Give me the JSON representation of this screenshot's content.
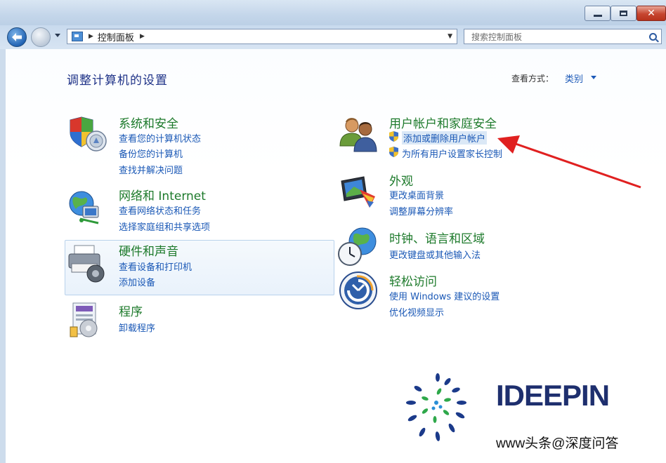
{
  "window": {
    "minimize_symbol": "",
    "close_symbol": "✕"
  },
  "nav": {
    "address": "控制面板",
    "search_placeholder": "搜索控制面板"
  },
  "page": {
    "title": "调整计算机的设置",
    "view_by_label": "查看方式：",
    "view_by_value": "类别"
  },
  "categories": [
    {
      "title": "系统和安全",
      "icon": "shield-icon",
      "links": [
        "查看您的计算机状态",
        "备份您的计算机",
        "查找并解决问题"
      ]
    },
    {
      "title": "网络和 Internet",
      "icon": "network-globe-icon",
      "links": [
        "查看网络状态和任务",
        "选择家庭组和共享选项"
      ]
    },
    {
      "title": "硬件和声音",
      "icon": "printer-icon",
      "links": [
        "查看设备和打印机",
        "添加设备"
      ]
    },
    {
      "title": "程序",
      "icon": "programs-icon",
      "links": [
        "卸载程序"
      ]
    },
    {
      "title": "用户帐户和家庭安全",
      "icon": "users-icon",
      "links": [
        "添加或删除用户帐户",
        "为所有用户设置家长控制"
      ]
    },
    {
      "title": "外观",
      "icon": "appearance-monitor-icon",
      "links": [
        "更改桌面背景",
        "调整屏幕分辨率"
      ]
    },
    {
      "title": "时钟、语言和区域",
      "icon": "clock-globe-icon",
      "links": [
        "更改键盘或其他输入法"
      ]
    },
    {
      "title": "轻松访问",
      "icon": "ease-of-access-icon",
      "links": [
        "使用 Windows 建议的设置",
        "优化视频显示"
      ]
    }
  ],
  "watermark": {
    "brand": "IDEEPIN",
    "tagline": "",
    "credit": "www头条@深度问答"
  },
  "colors": {
    "category_title": "#1d7a2b",
    "link": "#1a58b6",
    "heading": "#1e3287",
    "annotation_arrow": "#e02020"
  }
}
